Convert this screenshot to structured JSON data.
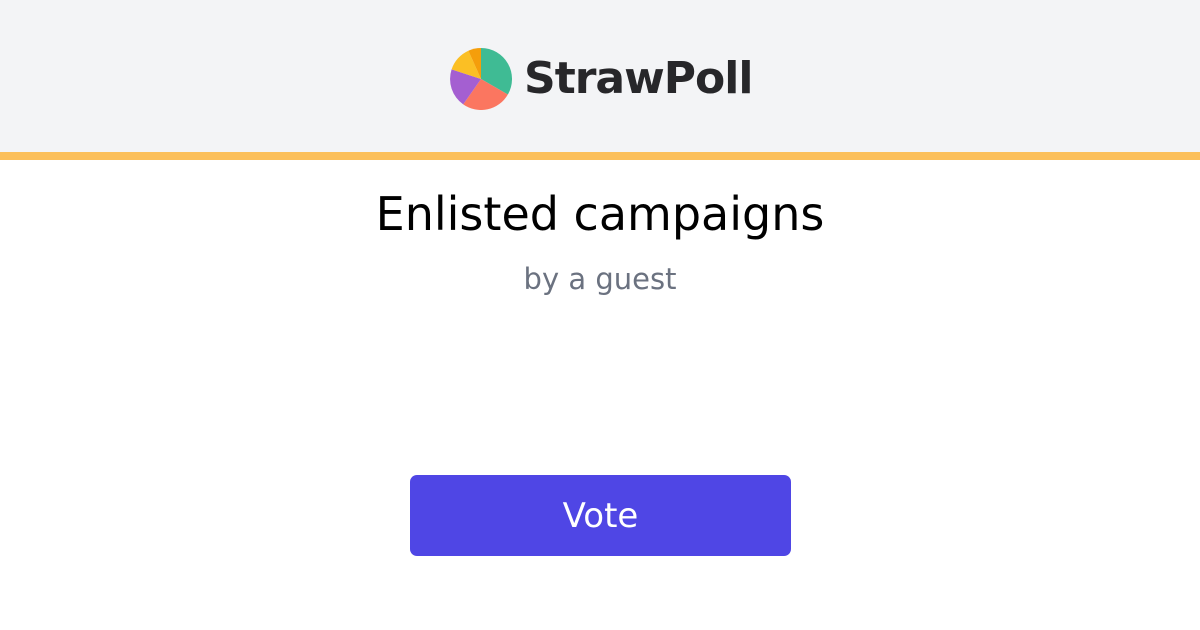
{
  "brand": {
    "name": "StrawPoll",
    "logo_icon": "pie-chart-logo-icon"
  },
  "poll": {
    "title": "Enlisted campaigns",
    "author": "by a guest"
  },
  "vote_button": {
    "label": "Vote"
  },
  "colors": {
    "header_background": "#f3f4f6",
    "accent_bar": "#fbbf5a",
    "button_background": "#4f46e5",
    "title_text": "#000000",
    "author_text": "#6b7280",
    "logo_green": "#3fbb94",
    "logo_coral": "#fb7660",
    "logo_purple": "#a45fd1",
    "logo_yellow": "#fbbf24",
    "logo_orange": "#f59e0b"
  }
}
